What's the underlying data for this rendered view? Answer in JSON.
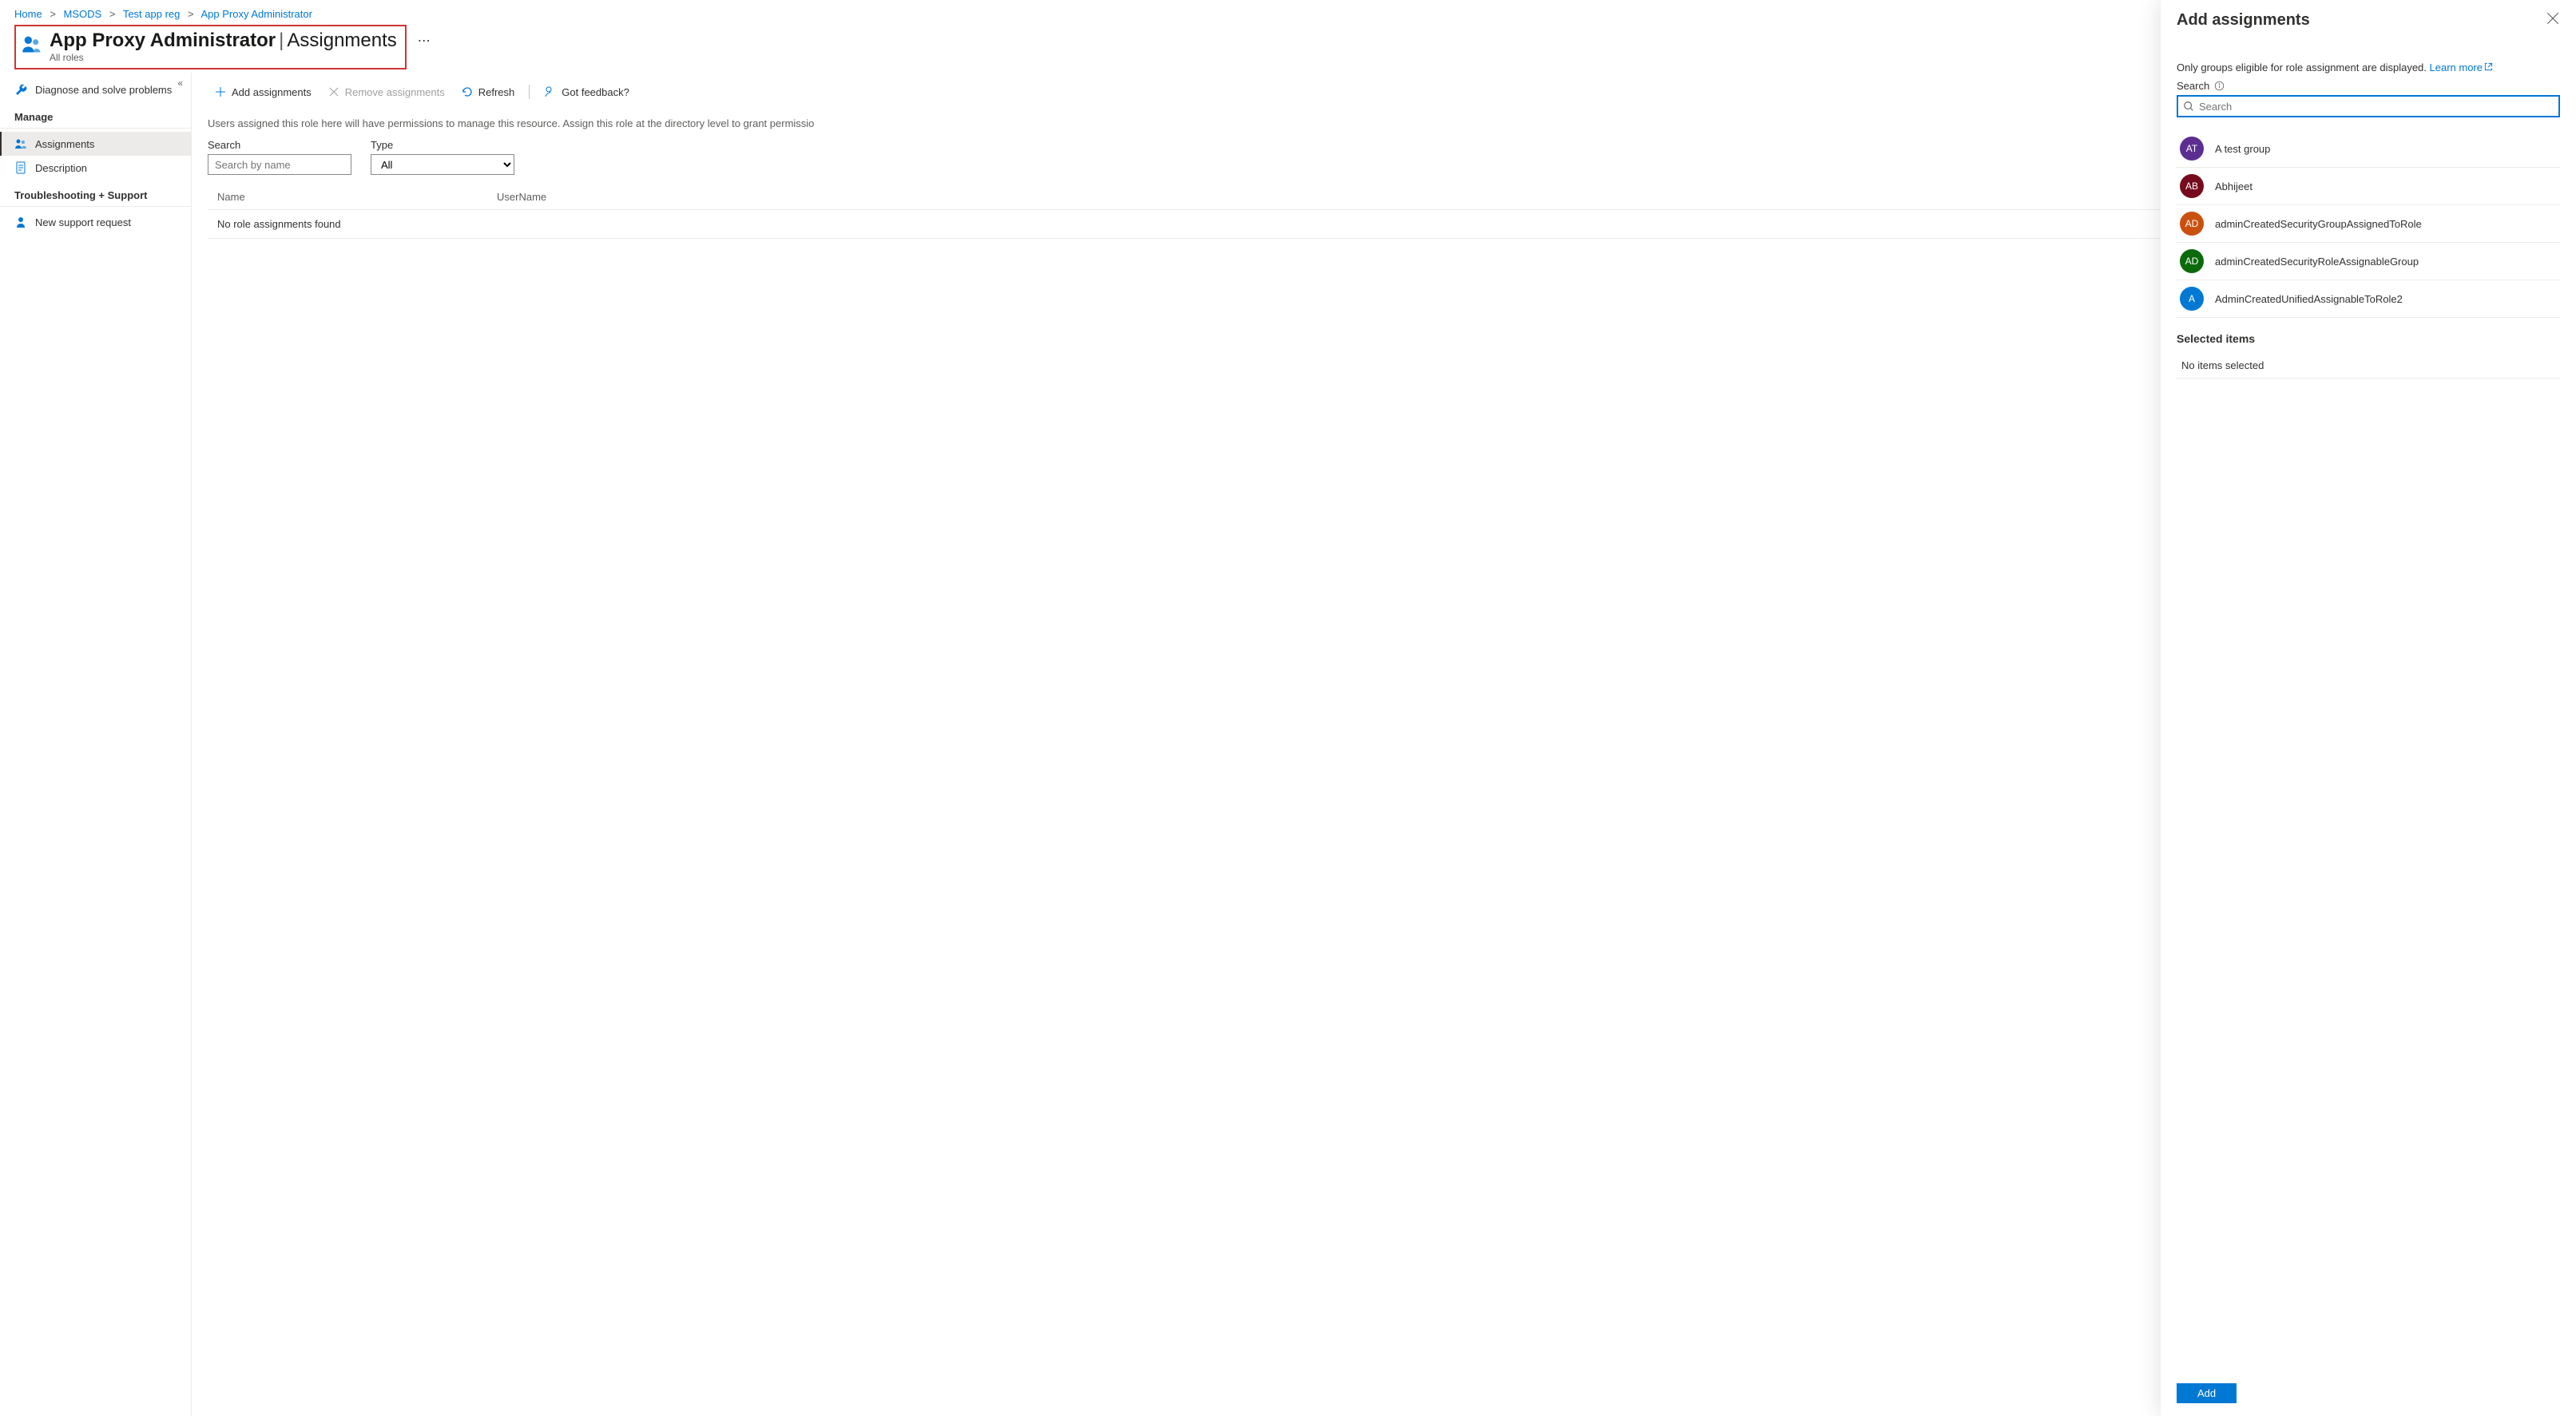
{
  "breadcrumb": {
    "items": [
      "Home",
      "MSODS",
      "Test app reg",
      "App Proxy Administrator"
    ]
  },
  "header": {
    "title_main": "App Proxy Administrator",
    "title_sub": "Assignments",
    "subtitle": "All roles"
  },
  "sidebar": {
    "diagnose": "Diagnose and solve problems",
    "manage_section": "Manage",
    "assignments": "Assignments",
    "description": "Description",
    "troubleshoot_section": "Troubleshooting + Support",
    "support_request": "New support request"
  },
  "toolbar": {
    "add": "Add assignments",
    "remove": "Remove assignments",
    "refresh": "Refresh",
    "feedback": "Got feedback?"
  },
  "main": {
    "info": "Users assigned this role here will have permissions to manage this resource. Assign this role at the directory level to grant permissio",
    "search_label": "Search",
    "search_placeholder": "Search by name",
    "type_label": "Type",
    "type_value": "All",
    "col_name": "Name",
    "col_user": "UserName",
    "empty": "No role assignments found"
  },
  "panel": {
    "title": "Add assignments",
    "hint": "Only groups eligible for role assignment are displayed.",
    "learn_more": "Learn more",
    "search_label": "Search",
    "search_placeholder": "Search",
    "results": [
      {
        "initials": "AT",
        "color": "#5c2e91",
        "name": "A test group"
      },
      {
        "initials": "AB",
        "color": "#750b1c",
        "name": "Abhijeet"
      },
      {
        "initials": "AD",
        "color": "#ca5010",
        "name": "adminCreatedSecurityGroupAssignedToRole"
      },
      {
        "initials": "AD",
        "color": "#0b6a0b",
        "name": "adminCreatedSecurityRoleAssignableGroup"
      },
      {
        "initials": "A",
        "color": "#0078d4",
        "name": "AdminCreatedUnifiedAssignableToRole2"
      }
    ],
    "selected_heading": "Selected items",
    "selected_empty": "No items selected",
    "add_button": "Add"
  }
}
